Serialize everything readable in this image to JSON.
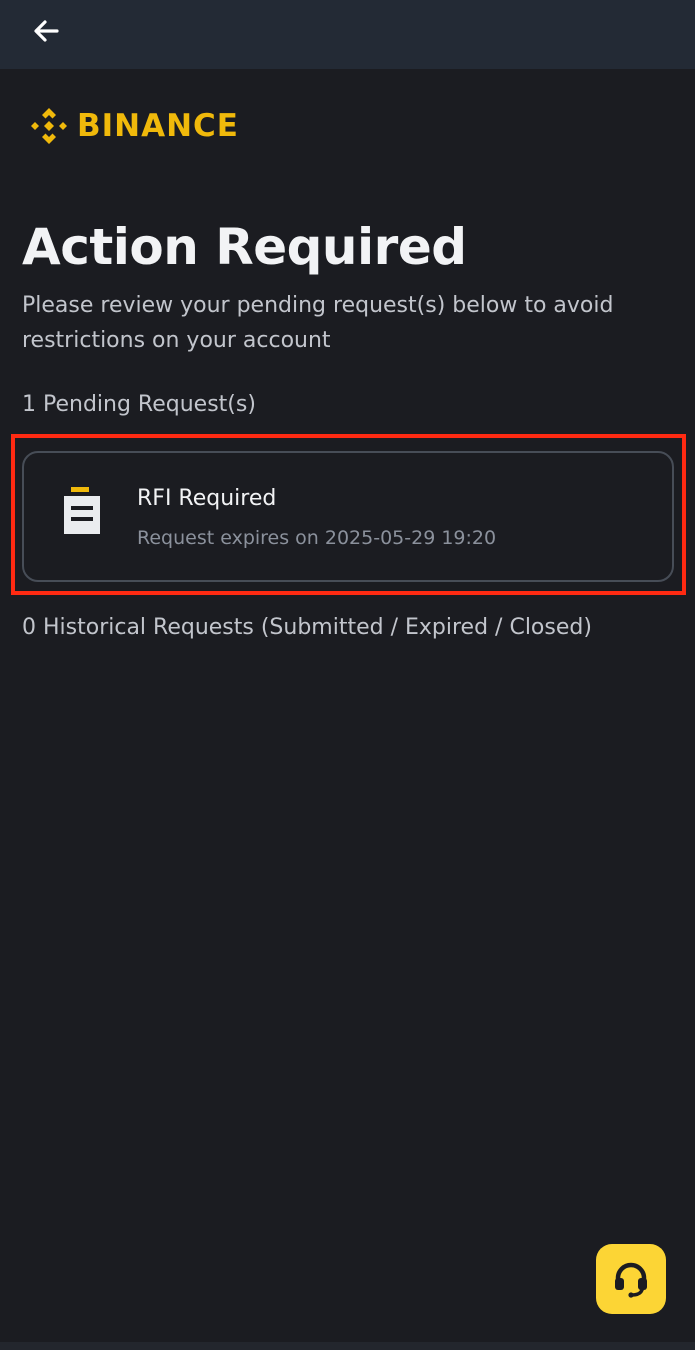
{
  "header": {
    "back_icon": "arrow-left-icon"
  },
  "logo": {
    "text": "BINANCE",
    "color": "#f0b90b"
  },
  "main": {
    "title": "Action Required",
    "subtitle": "Please review your pending request(s) below to avoid restrictions on your account",
    "pending_label": "1 Pending Request(s)",
    "requests": [
      {
        "icon": "document-icon",
        "title": "RFI Required",
        "subtitle": "Request expires on 2025-05-29 19:20"
      }
    ],
    "historical_label": "0 Historical Requests (Submitted / Expired / Closed)"
  },
  "support": {
    "icon": "headset-icon",
    "color": "#fcd535"
  },
  "colors": {
    "background": "#1b1c21",
    "highlight": "#ff2a12",
    "topbar": "#232a35"
  }
}
